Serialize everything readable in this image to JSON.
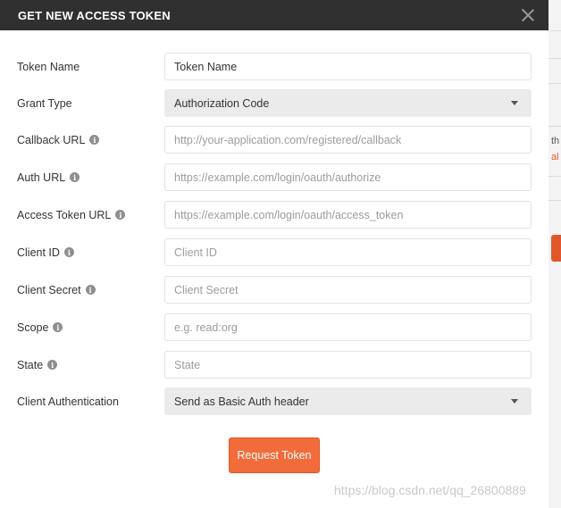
{
  "modal": {
    "title": "GET NEW ACCESS TOKEN",
    "close_icon": "close-icon"
  },
  "fields": [
    {
      "label": "Token Name",
      "value": "Token Name",
      "placeholder": "",
      "info": false,
      "type": "text"
    },
    {
      "label": "Grant Type",
      "value": "Authorization Code",
      "placeholder": "",
      "info": false,
      "type": "select"
    },
    {
      "label": "Callback URL",
      "value": "",
      "placeholder": "http://your-application.com/registered/callback",
      "info": true,
      "type": "text"
    },
    {
      "label": "Auth URL",
      "value": "",
      "placeholder": "https://example.com/login/oauth/authorize",
      "info": true,
      "type": "text"
    },
    {
      "label": "Access Token URL",
      "value": "",
      "placeholder": "https://example.com/login/oauth/access_token",
      "info": true,
      "type": "text"
    },
    {
      "label": "Client ID",
      "value": "",
      "placeholder": "Client ID",
      "info": true,
      "type": "text"
    },
    {
      "label": "Client Secret",
      "value": "",
      "placeholder": "Client Secret",
      "info": true,
      "type": "text"
    },
    {
      "label": "Scope",
      "value": "",
      "placeholder": "e.g. read:org",
      "info": true,
      "type": "text"
    },
    {
      "label": "State",
      "value": "",
      "placeholder": "State",
      "info": true,
      "type": "text"
    },
    {
      "label": "Client Authentication",
      "value": "Send as Basic Auth header",
      "placeholder": "",
      "info": false,
      "type": "select"
    }
  ],
  "info_glyph": "i",
  "actions": {
    "request_token_label": "Request Token"
  },
  "background": {
    "partial_text_1": "th",
    "partial_text_2": "al"
  },
  "watermark": "https://blog.csdn.net/qq_26800889",
  "colors": {
    "header_bg": "#303030",
    "accent": "#f26b3a",
    "select_bg": "#ebebeb"
  }
}
